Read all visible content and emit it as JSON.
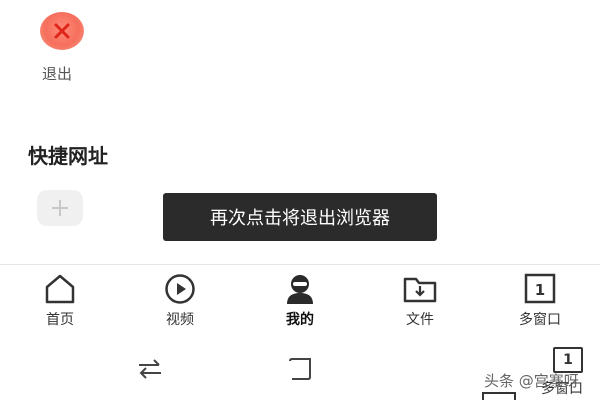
{
  "exit": {
    "label": "退出",
    "icon": "close-icon"
  },
  "quick_links": {
    "title": "快捷网址",
    "add_icon": "plus-icon"
  },
  "toast": {
    "text": "再次点击将退出浏览器"
  },
  "tabs": [
    {
      "label": "首页",
      "icon": "home-icon",
      "active": false
    },
    {
      "label": "视频",
      "icon": "play-icon",
      "active": false
    },
    {
      "label": "我的",
      "icon": "profile-icon",
      "active": true
    },
    {
      "label": "文件",
      "icon": "folder-download-icon",
      "active": false
    },
    {
      "label": "多窗口",
      "icon": "window-count-icon",
      "badge": "1",
      "active": false
    }
  ],
  "system_nav": {
    "back_icon": "swap-icon",
    "home_icon": "square-icon",
    "window_badge": "1",
    "window_label": "多窗口"
  },
  "watermark": {
    "text": "头条 @宫寨呀"
  },
  "colors": {
    "exit_bg": "#f66f5c",
    "toast_bg": "#2b2b2b",
    "text": "#333333"
  }
}
